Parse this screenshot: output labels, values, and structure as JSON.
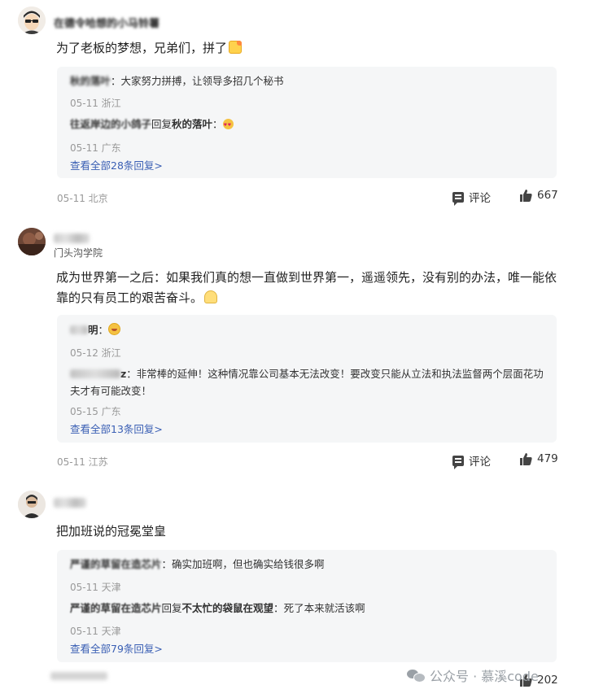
{
  "comments": [
    {
      "author": "在德令哈想的小马铃薯",
      "subtitle": "",
      "text": "为了老板的梦想，兄弟们，拼了",
      "replies": [
        {
          "name": "秋的落叶",
          "sep": "：",
          "text": "大家努力拼搏，让领导多招几个秘书",
          "meta": "05-11 浙江"
        },
        {
          "name": "往返岸边的小鸽子",
          "verb": "回复",
          "target": "秋的落叶",
          "sep": "：",
          "text": "",
          "meta": "05-11 广东"
        }
      ],
      "see_all": "查看全部28条回复>",
      "meta": "05-11 北京",
      "comment_label": "评论",
      "likes": "667"
    },
    {
      "author": "",
      "subtitle": "门头沟学院",
      "text": "成为世界第一之后：如果我们真的想一直做到世界第一，遥遥领先，没有别的办法，唯一能依靠的只有员工的艰苦奋斗。",
      "replies": [
        {
          "name": "明",
          "sep": "：",
          "text": "",
          "meta": "05-12 浙江"
        },
        {
          "name": "z",
          "sep": "：",
          "text": "非常棒的延伸！这种情况靠公司基本无法改变！要改变只能从立法和执法监督两个层面花功夫才有可能改变！",
          "meta": "05-15 广东"
        }
      ],
      "see_all": "查看全部13条回复>",
      "meta": "05-11 江苏",
      "comment_label": "评论",
      "likes": "479"
    },
    {
      "author": "",
      "subtitle": "",
      "text": "把加班说的冠冕堂皇",
      "replies": [
        {
          "name": "严谨的草留在造芯片",
          "sep": "：",
          "text": "确实加班啊，但也确实给钱很多啊",
          "meta": "05-11 天津"
        },
        {
          "name": "严谨的草留在造芯片",
          "verb": "回复",
          "target": "不太忙的袋鼠在观望",
          "sep": "：",
          "text": "死了本来就活该啊",
          "meta": "05-11 天津"
        }
      ],
      "see_all": "查看全部79条回复>",
      "meta": "",
      "comment_label": "评论",
      "likes": "202"
    }
  ],
  "watermark": "公众号 · 慕溪code",
  "icons": {
    "comment": "comment-bubble-icon",
    "like": "thumbs-up-icon",
    "wechat": "wechat-icon"
  },
  "colors": {
    "link": "#3a5fb4",
    "reply_bg": "#f5f6f7",
    "meta": "#999999"
  }
}
